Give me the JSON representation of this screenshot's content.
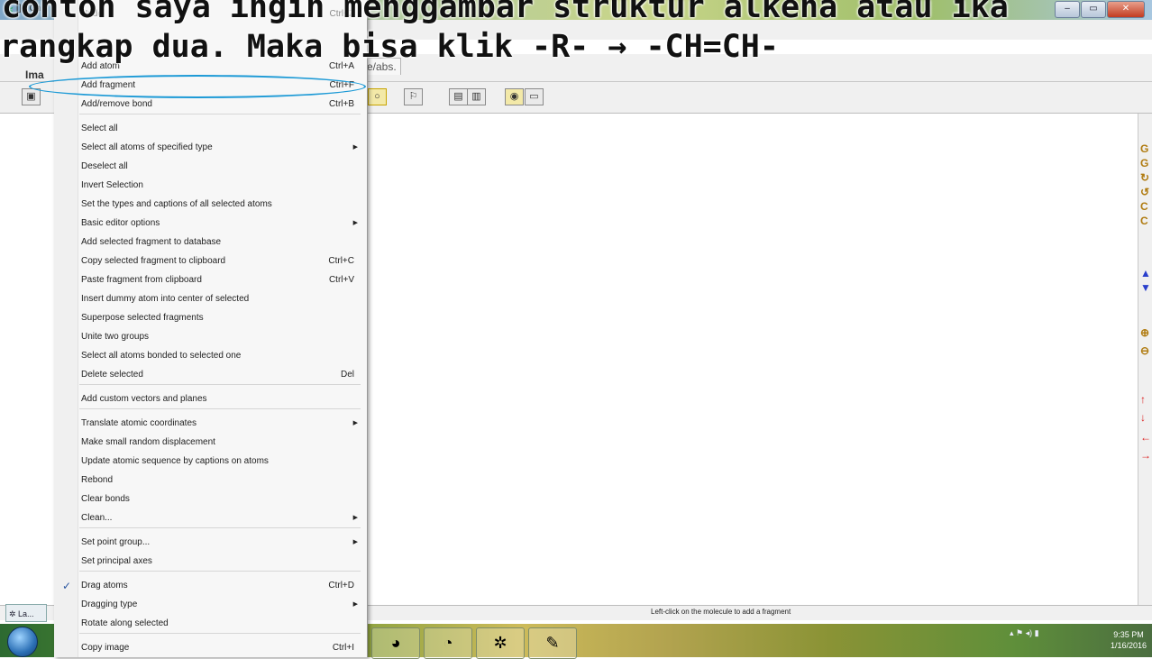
{
  "window": {
    "title_short": "[] - Ch"
  },
  "caption": {
    "line1": "contoh saya ingin menggambar struktur alkena atau ika",
    "line2": "rangkap dua. Maka bisa klik -R- → -CH=CH-"
  },
  "tabs": {
    "image": "Ima",
    "labs": "e/abs."
  },
  "status": {
    "message": "Left-click on the molecule to add a fragment",
    "taskbar_app": "La..."
  },
  "clock": {
    "time": "9:35 PM",
    "date": "1/16/2016"
  },
  "context_menu": {
    "items": [
      {
        "label": "Undo",
        "shortcut": "Ctrl+Z",
        "disabled": true
      },
      {
        "label": "Add atom",
        "shortcut": "Ctrl+A"
      },
      {
        "label": "Add fragment",
        "shortcut": "Ctrl+F"
      },
      {
        "label": "Add/remove bond",
        "shortcut": "Ctrl+B"
      },
      {
        "label": "Select all"
      },
      {
        "label": "Select all atoms of specified type",
        "submenu": true
      },
      {
        "label": "Deselect all"
      },
      {
        "label": "Invert Selection"
      },
      {
        "label": "Set the types and captions of all selected atoms"
      },
      {
        "label": "Basic editor options",
        "submenu": true
      },
      {
        "label": "Add selected fragment to database"
      },
      {
        "label": "Copy selected fragment to clipboard",
        "shortcut": "Ctrl+C"
      },
      {
        "label": "Paste fragment from clipboard",
        "shortcut": "Ctrl+V"
      },
      {
        "label": "Insert dummy atom into center of selected"
      },
      {
        "label": "Superpose selected fragments"
      },
      {
        "label": "Unite two groups"
      },
      {
        "label": "Select all atoms bonded to selected one"
      },
      {
        "label": "Delete selected",
        "shortcut": "Del"
      },
      {
        "label": "Add custom vectors and planes"
      },
      {
        "label": "Translate atomic coordinates",
        "submenu": true
      },
      {
        "label": "Make small random displacement"
      },
      {
        "label": "Update atomic sequence by captions on atoms"
      },
      {
        "label": "Rebond"
      },
      {
        "label": "Clear bonds"
      },
      {
        "label": "Clean...",
        "submenu": true
      },
      {
        "label": "Set point group...",
        "submenu": true
      },
      {
        "label": "Set principal axes"
      },
      {
        "label": "Drag atoms",
        "shortcut": "Ctrl+D",
        "checked": true
      },
      {
        "label": "Dragging type",
        "submenu": true
      },
      {
        "label": "Rotate along selected"
      },
      {
        "label": "Copy image",
        "shortcut": "Ctrl+I"
      }
    ]
  },
  "colors": {
    "highlight": "#1d9ad6",
    "menu_bg": "#f7f7f7"
  },
  "icons": {
    "right_toolbar": [
      "rotate-icon",
      "rotate-icon",
      "rotate-cw-icon",
      "rotate-ccw-icon",
      "rotate-icon",
      "rotate-icon",
      "arrow-up-icon",
      "arrow-down-icon",
      "zoom-in-icon",
      "zoom-out-icon",
      "move-up-icon",
      "move-down-icon",
      "move-left-icon",
      "move-right-icon"
    ]
  }
}
